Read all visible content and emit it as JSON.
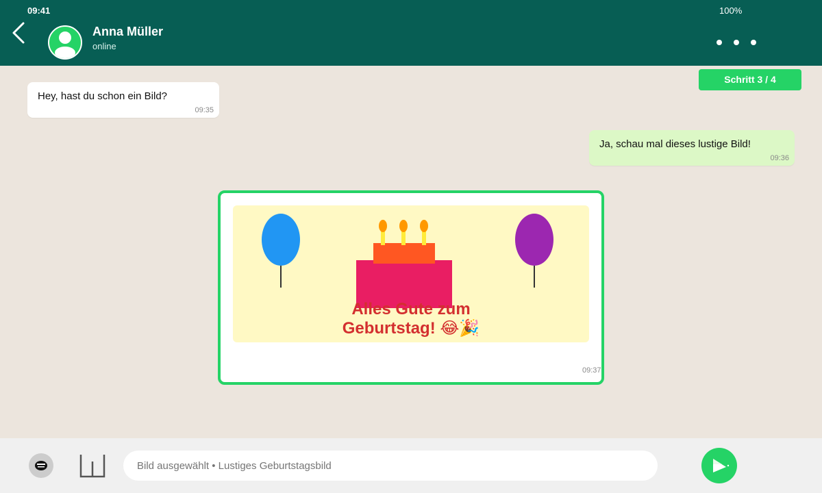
{
  "status_bar": {
    "time": "09:41",
    "battery": "100%"
  },
  "header": {
    "contact_name": "Anna Müller",
    "contact_status": "online"
  },
  "progress": {
    "label": "Schritt 3 / 4",
    "current": 3,
    "total": 4
  },
  "messages": [
    {
      "direction": "incoming",
      "text": "Hey, hast du schon ein Bild?",
      "time": "09:35"
    },
    {
      "direction": "outgoing",
      "text": "Ja, schau mal dieses lustige Bild!",
      "time": "09:36"
    },
    {
      "direction": "outgoing",
      "type": "image",
      "caption_line1": "Alles Gute zum",
      "caption_line2": "Geburtstag! 😂🎉",
      "time": "09:37"
    }
  ],
  "composer": {
    "value": "",
    "placeholder": "Bild ausgewählt • Lustiges Geburtstagsbild"
  },
  "icons": {
    "back": "chevron-left-icon",
    "avatar": "user-icon",
    "menu": "more-dots-icon",
    "emoji": "emoji-icon",
    "attach": "attach-icon",
    "send": "send-icon"
  },
  "colors": {
    "header": "#075e54",
    "accent": "#25d366",
    "chat_background": "#ece5dd",
    "outgoing_bubble": "#dcf8c6",
    "incoming_bubble": "#ffffff",
    "image_background": "#fff9c4",
    "greeting_text": "#d32f2f",
    "balloon_left": "#2196f3",
    "balloon_right": "#9c27b0",
    "cake": "#e91e63",
    "cake_top": "#ff5722",
    "candle": "#ffeb3b",
    "flame": "#ff9800"
  }
}
